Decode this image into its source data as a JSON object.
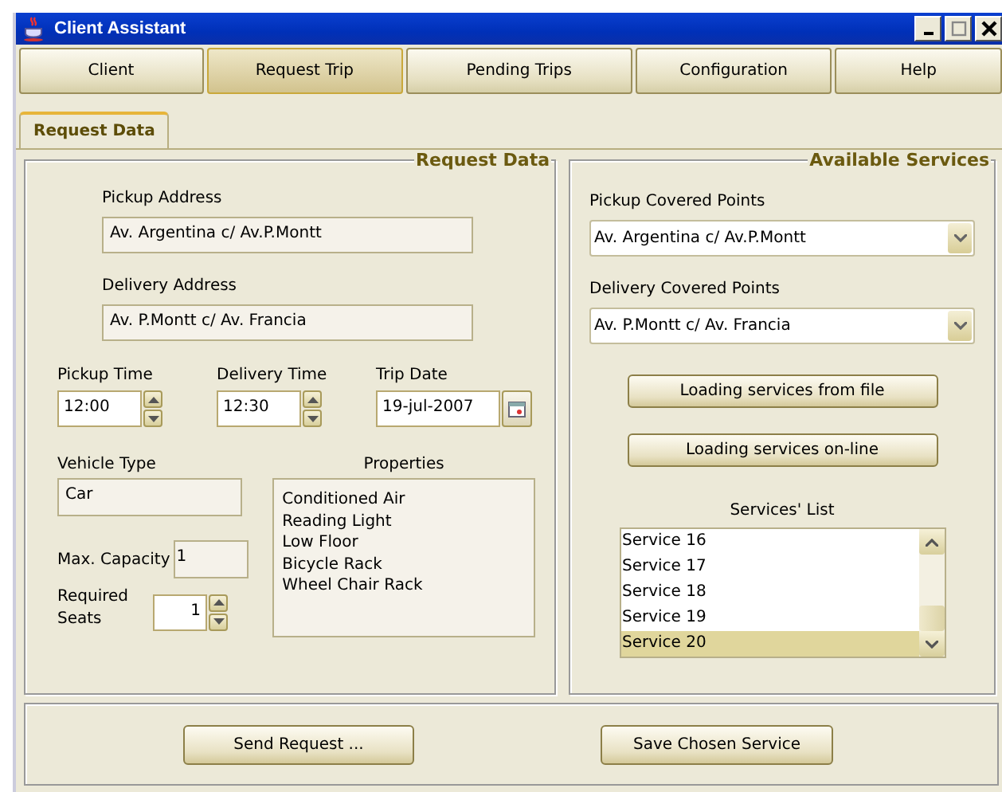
{
  "window": {
    "title": "Client Assistant"
  },
  "menu": [
    {
      "label": "Client",
      "selected": false
    },
    {
      "label": "Request Trip",
      "selected": true
    },
    {
      "label": "Pending Trips",
      "selected": false
    },
    {
      "label": "Configuration",
      "selected": false
    },
    {
      "label": "Help",
      "selected": false
    }
  ],
  "tabs": [
    {
      "label": "Request Data",
      "selected": true
    }
  ],
  "request_data": {
    "title": "Request Data",
    "pickup_address": {
      "label": "Pickup Address",
      "value": "Av. Argentina c/ Av.P.Montt"
    },
    "delivery_address": {
      "label": "Delivery Address",
      "value": "Av. P.Montt c/ Av. Francia"
    },
    "pickup_time": {
      "label": "Pickup Time",
      "value": "12:00"
    },
    "delivery_time": {
      "label": "Delivery Time",
      "value": "12:30"
    },
    "trip_date": {
      "label": "Trip Date",
      "value": "19-jul-2007"
    },
    "vehicle_type": {
      "label": "Vehicle Type",
      "value": "Car"
    },
    "properties": {
      "label": "Properties",
      "items": [
        "Conditioned Air",
        "Reading Light",
        "Low Floor",
        "Bicycle Rack",
        "Wheel Chair Rack"
      ]
    },
    "max_capacity": {
      "label": "Max. Capacity",
      "value": "1"
    },
    "required_seats": {
      "label": "Required Seats",
      "value": "1"
    }
  },
  "available_services": {
    "title": "Available Services",
    "pickup_covered_points": {
      "label": "Pickup Covered Points",
      "value": "Av. Argentina c/ Av.P.Montt"
    },
    "delivery_covered_points": {
      "label": "Delivery Covered Points",
      "value": "Av. P.Montt c/ Av. Francia"
    },
    "buttons": [
      "Loading services from file",
      "Loading services on-line"
    ],
    "services_list": {
      "label": "Services' List",
      "items": [
        {
          "label": "Service 16",
          "selected": false
        },
        {
          "label": "Service 17",
          "selected": false
        },
        {
          "label": "Service 18",
          "selected": false
        },
        {
          "label": "Service 19",
          "selected": false
        },
        {
          "label": "Service 20",
          "selected": true
        }
      ]
    }
  },
  "buttons": [
    "Send Request ...",
    "Save Chosen Service"
  ]
}
